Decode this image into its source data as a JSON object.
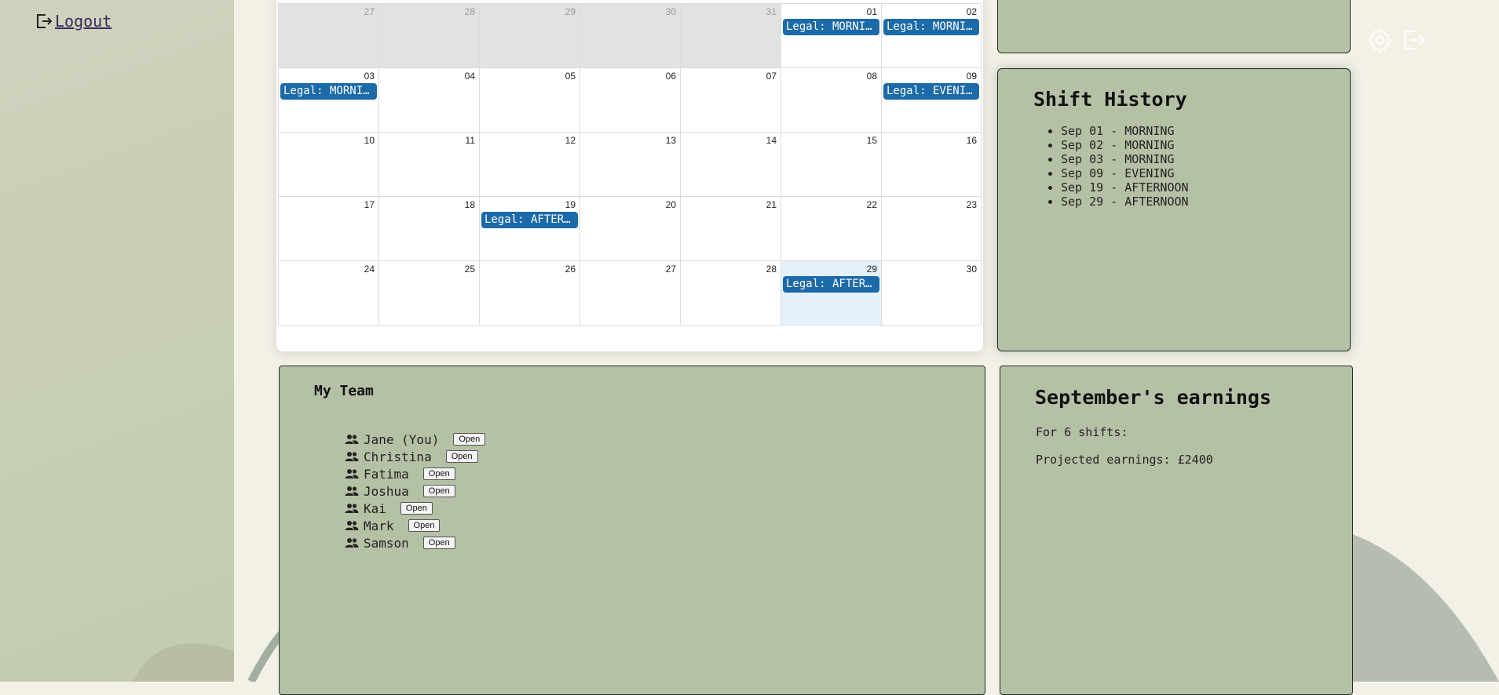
{
  "sidebar": {
    "logout_label": " Logout"
  },
  "calendar": {
    "weeks": [
      [
        {
          "day": "27",
          "other": true
        },
        {
          "day": "28",
          "other": true
        },
        {
          "day": "29",
          "other": true
        },
        {
          "day": "30",
          "other": true
        },
        {
          "day": "31",
          "other": true
        },
        {
          "day": "01",
          "event": "Legal: MORNING"
        },
        {
          "day": "02",
          "event": "Legal: MORNING"
        }
      ],
      [
        {
          "day": "03",
          "event": "Legal: MORNING"
        },
        {
          "day": "04"
        },
        {
          "day": "05"
        },
        {
          "day": "06"
        },
        {
          "day": "07"
        },
        {
          "day": "08"
        },
        {
          "day": "09",
          "event": "Legal: EVENING"
        }
      ],
      [
        {
          "day": "10"
        },
        {
          "day": "11"
        },
        {
          "day": "12"
        },
        {
          "day": "13"
        },
        {
          "day": "14"
        },
        {
          "day": "15"
        },
        {
          "day": "16"
        }
      ],
      [
        {
          "day": "17"
        },
        {
          "day": "18"
        },
        {
          "day": "19",
          "event": "Legal: AFTERNOON"
        },
        {
          "day": "20"
        },
        {
          "day": "21"
        },
        {
          "day": "22"
        },
        {
          "day": "23"
        }
      ],
      [
        {
          "day": "24"
        },
        {
          "day": "25"
        },
        {
          "day": "26"
        },
        {
          "day": "27"
        },
        {
          "day": "28"
        },
        {
          "day": "29",
          "today": true,
          "event": "Legal: AFTERNOON"
        },
        {
          "day": "30"
        }
      ]
    ]
  },
  "history": {
    "title": "Shift History",
    "items": [
      "Sep 01 - MORNING",
      "Sep 02 - MORNING",
      "Sep 03 - MORNING",
      "Sep 09 - EVENING",
      "Sep 19 - AFTERNOON",
      "Sep 29 - AFTERNOON"
    ]
  },
  "team": {
    "title": "My Team",
    "open_label": "Open",
    "members": [
      "Jane (You)",
      "Christina",
      "Fatima",
      "Joshua",
      "Kai",
      "Mark",
      "Samson"
    ]
  },
  "earnings": {
    "title": "September's earnings",
    "shifts_text": "For 6 shifts:",
    "projected_text": "Projected earnings: £2400"
  },
  "colors": {
    "event": "#1c6aa8",
    "panel": "#b5c1a5",
    "sidebar": "#c8cfb5",
    "today": "#e5f1fa"
  }
}
